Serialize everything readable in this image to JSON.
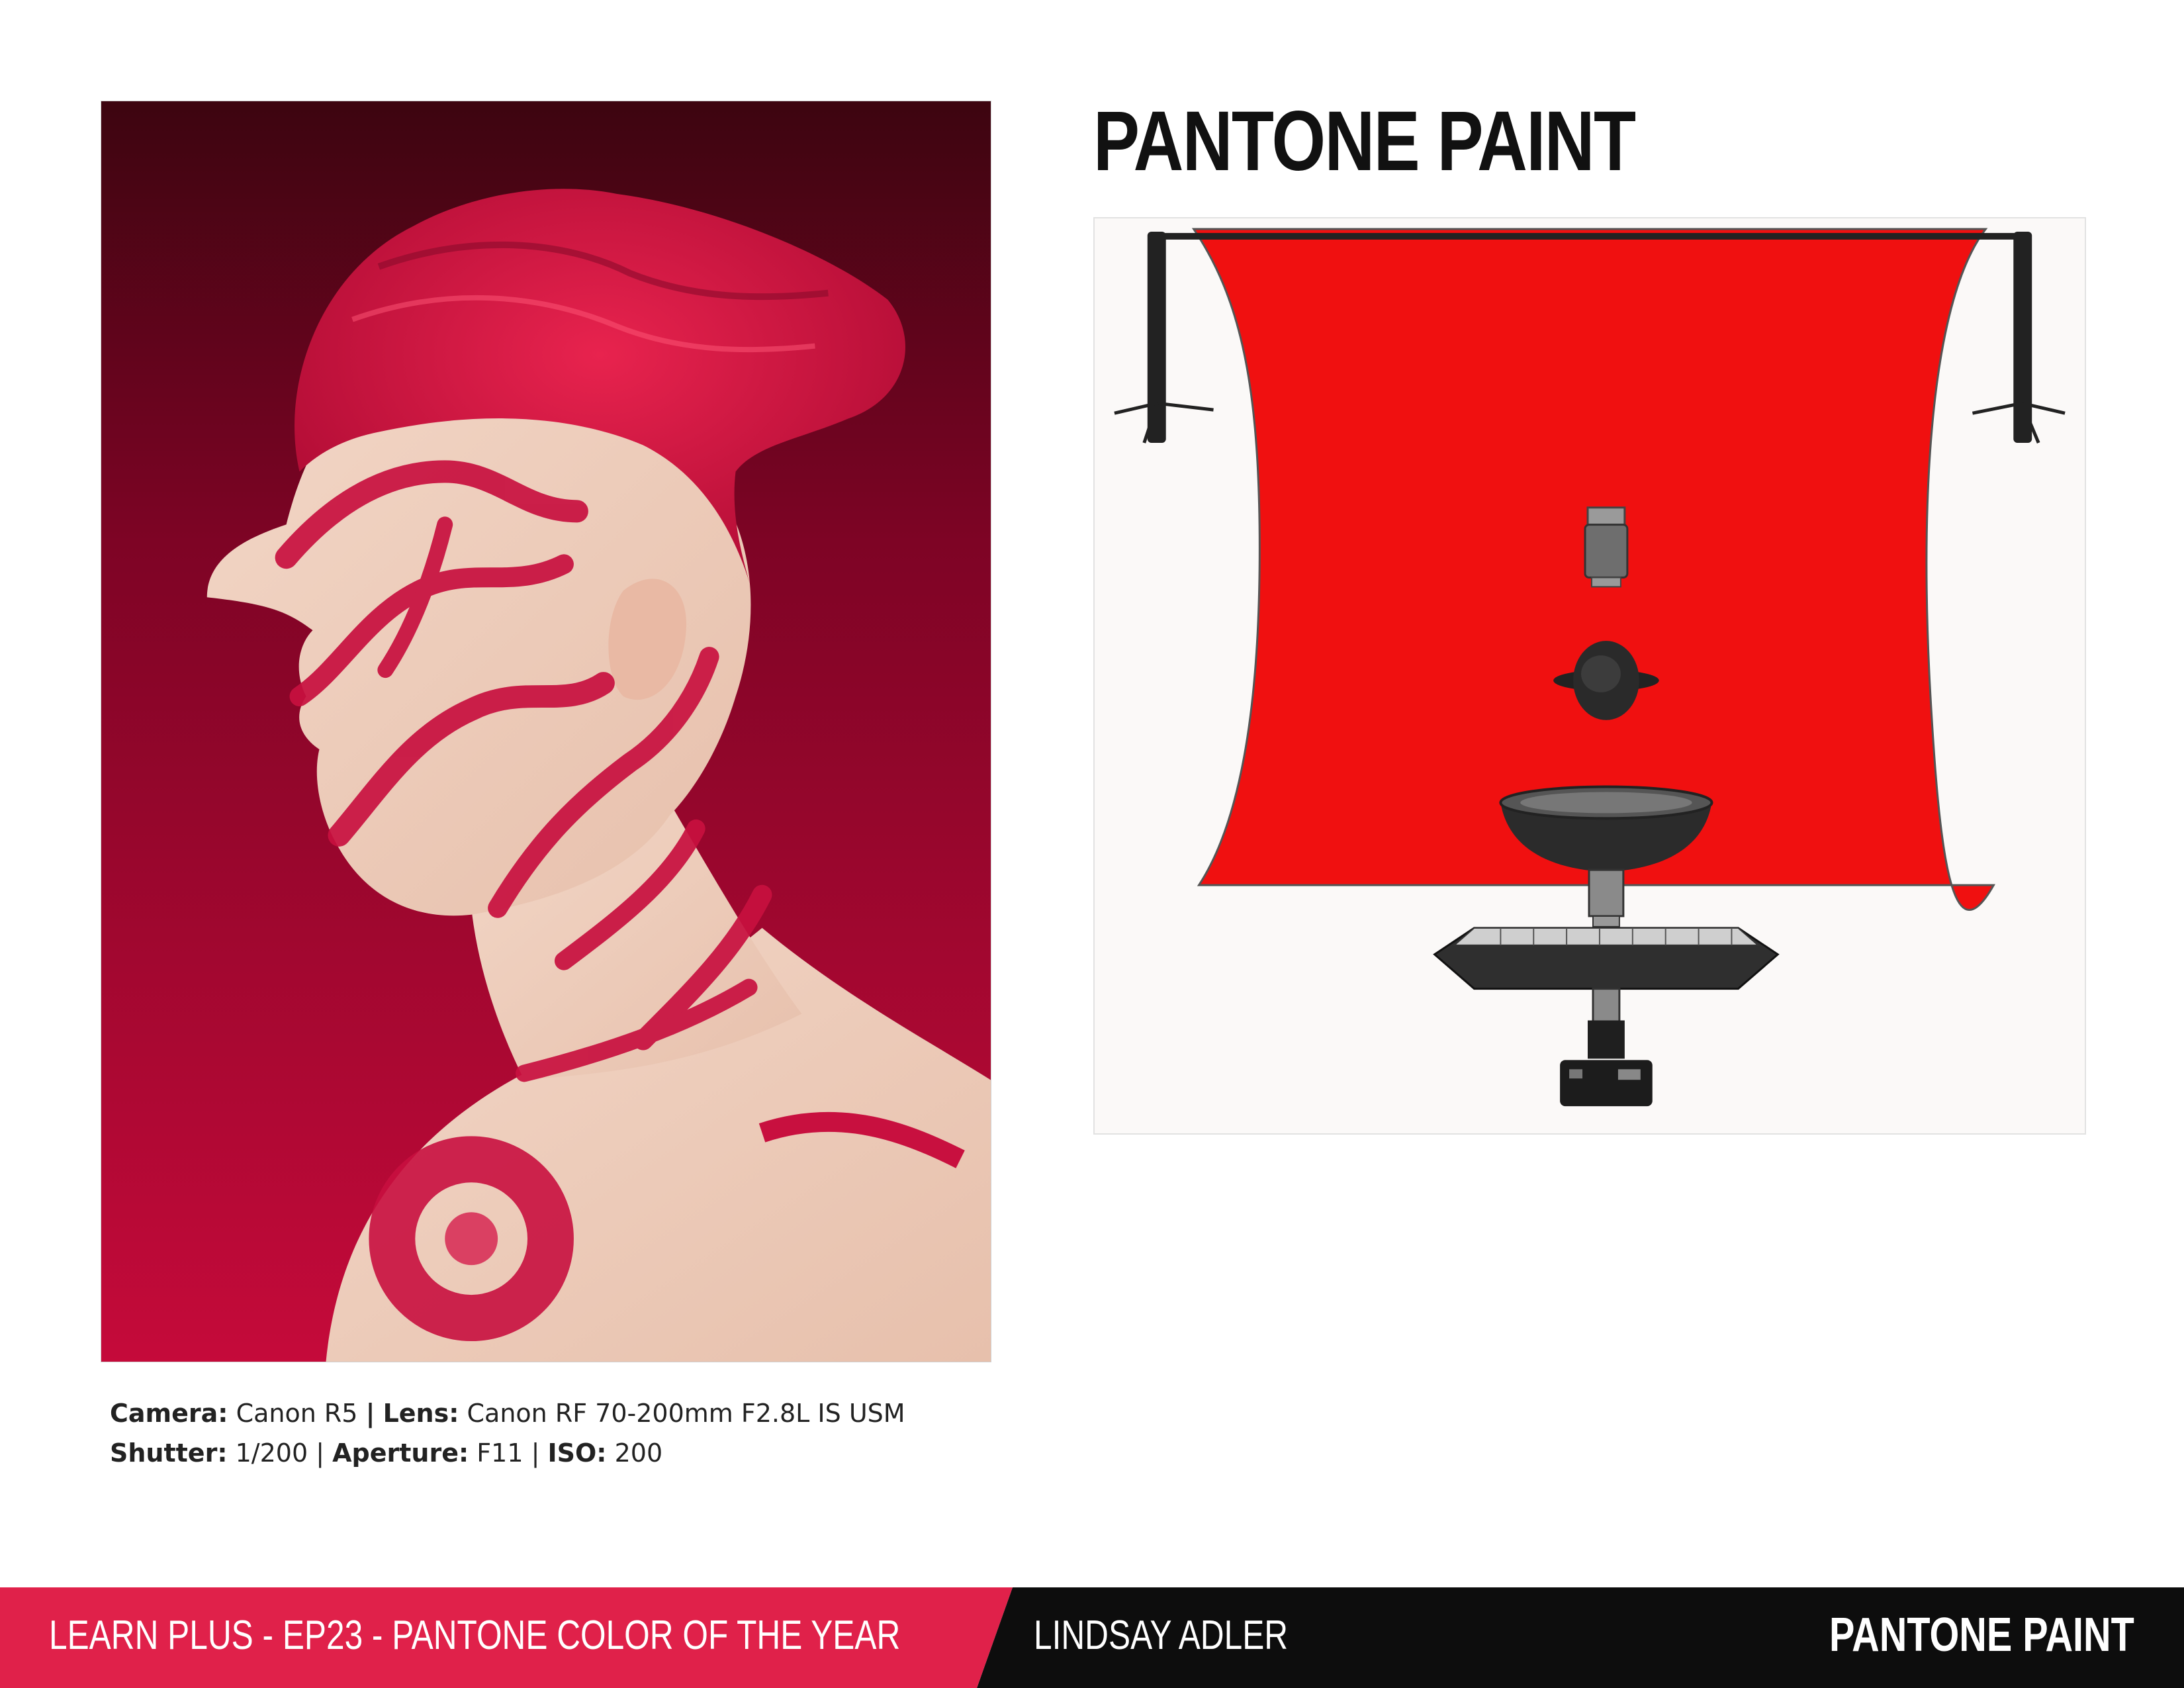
{
  "title": "PANTONE PAINT",
  "photo": {
    "subject": "portrait-photo"
  },
  "diagram": {
    "backdrop_color": "#f01010"
  },
  "specs": {
    "camera_label": "Camera:",
    "camera_value": "Canon R5",
    "separator": "|",
    "lens_label": "Lens:",
    "lens_value": "Canon RF 70-200mm F2.8L IS USM",
    "shutter_label": "Shutter:",
    "shutter_value": "1/200",
    "aperture_label": "Aperture:",
    "aperture_value": "F11",
    "iso_label": "ISO:",
    "iso_value": "200"
  },
  "footer": {
    "series": "LEARN PLUS - EP23 - PANTONE COLOR OF THE YEAR",
    "author": "LINDSAY ADLER",
    "brand": "PANTONE PAINT",
    "accent_color": "#e0214a"
  }
}
